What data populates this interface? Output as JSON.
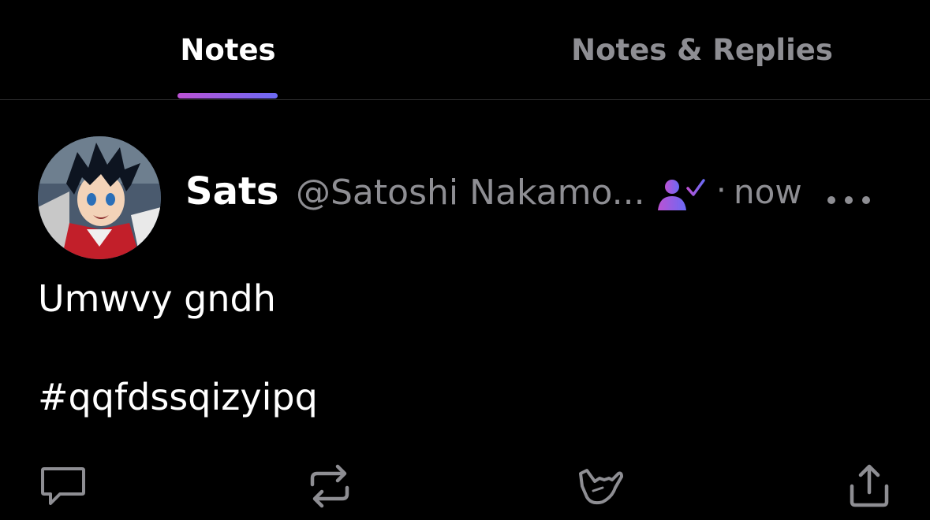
{
  "tabs": {
    "notes": "Notes",
    "notes_replies": "Notes & Replies",
    "active": "Notes"
  },
  "note": {
    "author_name": "Sats",
    "author_handle": "@Satoshi Nakamo...",
    "separator": "·",
    "timestamp": "now",
    "text": "Umwvy gndh",
    "hashtag": "#qqfdssqizyipq",
    "icons": {
      "verified": "user-check-icon",
      "more": "ellipsis-icon",
      "reply": "comment-icon",
      "repost": "repost-icon",
      "zap": "shaka-hand-icon",
      "share": "share-icon"
    }
  },
  "colors": {
    "background": "#000000",
    "text_primary": "#ffffff",
    "text_secondary": "#8e8e93",
    "accent_start": "#bb52d3",
    "accent_end": "#6b6af5",
    "icon": "#8e8e93"
  }
}
